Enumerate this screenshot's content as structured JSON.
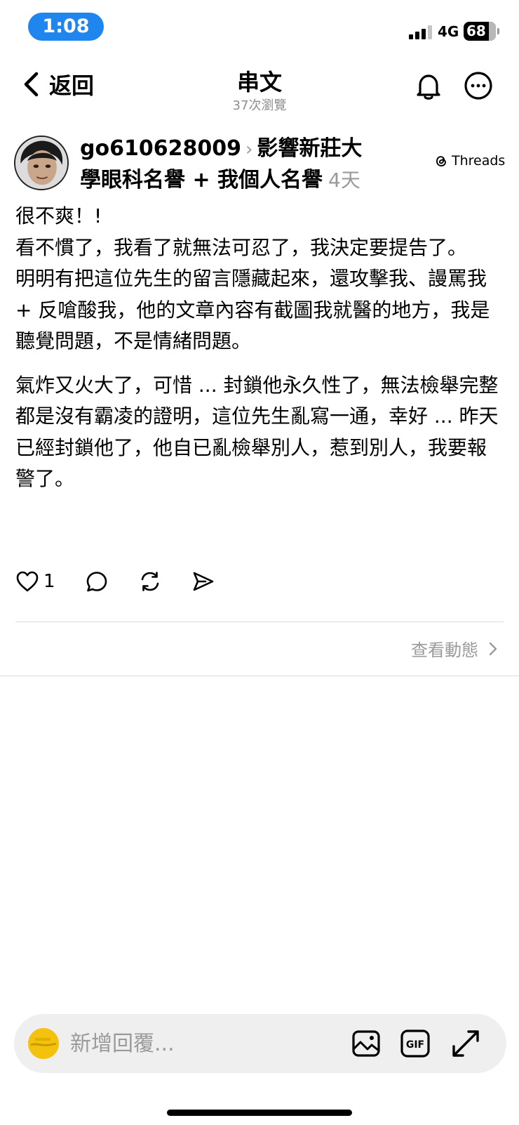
{
  "status_bar": {
    "time": "1:08",
    "network": "4G",
    "battery": "68"
  },
  "header": {
    "back_label": "返回",
    "title": "串文",
    "views": "37次瀏覽"
  },
  "post": {
    "username": "go610628009",
    "context_line1": "影響新莊大",
    "context_line2": "學眼科名譽 + 我個人名譽",
    "age": "4天",
    "source_badge": "Threads",
    "paragraphs": [
      "很不爽！!",
      "看不慣了，我看了就無法可忍了，我決定要提告了。",
      "明明有把這位先生的留言隱藏起來，還攻擊我、謾罵我 + 反嗆酸我，他的文章內容有截圖我就醫的地方，我是聽覺問題，不是情緒問題。",
      "氣炸又火大了，可惜 ... 封鎖他永久性了，無法檢舉完整都是沒有霸凌的證明，這位先生亂寫一通，幸好 ... 昨天已經封鎖他了，他自已亂檢舉別人，惹到別人，我要報警了。"
    ],
    "like_count": "1"
  },
  "activity_link": "查看動態",
  "reply": {
    "placeholder": "新增回覆..."
  },
  "icons": {
    "back": "chevron-left-icon",
    "bell": "bell-icon",
    "more": "more-icon",
    "like": "heart-icon",
    "comment": "comment-icon",
    "repost": "repost-icon",
    "share": "send-icon",
    "image": "image-icon",
    "gif": "gif-icon",
    "expand": "expand-icon"
  }
}
